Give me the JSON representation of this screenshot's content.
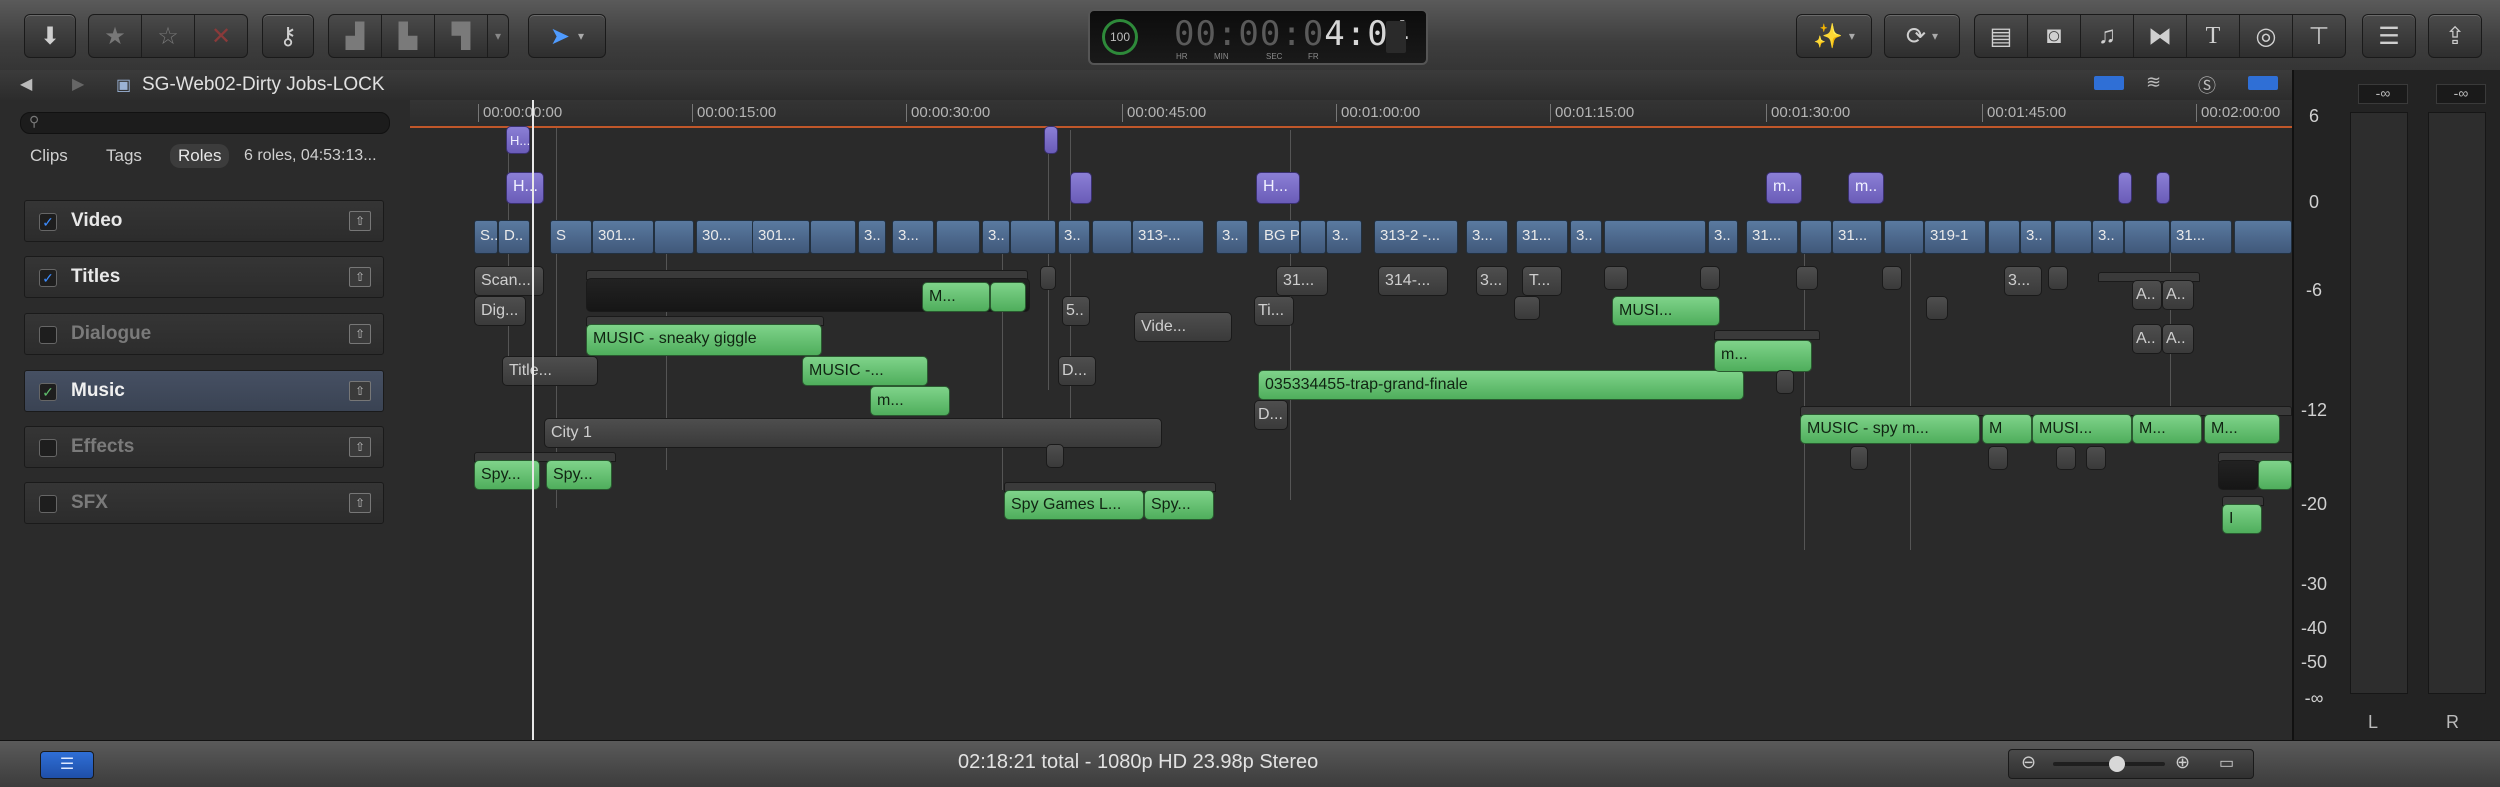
{
  "toolbar": {
    "timecode": {
      "percent": "100",
      "percent_unit": "%",
      "dim_digits": "00:00:0",
      "bright_digits": "4:04",
      "labels": [
        "HR",
        "MIN",
        "SEC",
        "FR"
      ]
    }
  },
  "titlebar": {
    "project_name": "SG-Web02-Dirty Jobs-LOCK"
  },
  "index": {
    "tabs": [
      "Clips",
      "Tags",
      "Roles"
    ],
    "selected_tab": "Roles",
    "summary": "6 roles, 04:53:13...",
    "roles": [
      {
        "label": "Video",
        "checked": true,
        "active": false
      },
      {
        "label": "Titles",
        "checked": true,
        "active": false
      },
      {
        "label": "Dialogue",
        "checked": false,
        "active": false
      },
      {
        "label": "Music",
        "checked": true,
        "active": true
      },
      {
        "label": "Effects",
        "checked": false,
        "active": false
      },
      {
        "label": "SFX",
        "checked": false,
        "active": false
      }
    ]
  },
  "ruler": {
    "ticks": [
      "00:00:00:00",
      "00:00:15:00",
      "00:00:30:00",
      "00:00:45:00",
      "00:01:00:00",
      "00:01:15:00",
      "00:01:30:00",
      "00:01:45:00",
      "00:02:00:00"
    ]
  },
  "primary_clips": [
    "S..",
    "D..",
    "S",
    "301...",
    "30...",
    "301...",
    "3..",
    "3...",
    "3..",
    "3..",
    "313-...",
    "3..",
    "BG P...",
    "3..",
    "313-2 -...",
    "3...",
    "31...",
    "3..",
    "3..",
    "31...",
    "31...",
    "319-1",
    "3..",
    "3..",
    "31..."
  ],
  "connected_clips": {
    "scan": "Scan...",
    "dig": "Dig...",
    "title": "Title...",
    "music_m": "M...",
    "sneaky": "MUSIC - sneaky giggle",
    "music_dash": "MUSIC -...",
    "m_short": "m...",
    "city": "City 1",
    "spy1": "Spy...",
    "spy2": "Spy...",
    "spy_games": "Spy Games L...",
    "spy3": "Spy...",
    "five": "5..",
    "d_short": "D...",
    "video": "Vide...",
    "ti": "Ti...",
    "thirty_one": "31...",
    "three_fourteen": "314-...",
    "three_dot": "3...",
    "t_short": "T...",
    "trap": "035334455-trap-grand-finale",
    "d2": "D...",
    "musi": "MUSI...",
    "m_dot": "m...",
    "spy_music": "MUSIC - spy m...",
    "m_single": "M",
    "musi2": "MUSI...",
    "m3": "M...",
    "m4": "M...",
    "a1": "A..",
    "a2": "A..",
    "a3": "A..",
    "a4": "A..",
    "h1": "H...",
    "h2": "H...",
    "h3": "H...",
    "m_purple1": "m..",
    "m_purple2": "m..",
    "three_second": "3...",
    "i_clip": "I"
  },
  "meters": {
    "peak_l": "-∞",
    "peak_r": "-∞",
    "scale": [
      "6",
      "0",
      "-6",
      "-12",
      "-20",
      "-30",
      "-40",
      "-50",
      "-∞"
    ],
    "channels": [
      "L",
      "R"
    ]
  },
  "statusbar": {
    "summary": "02:18:21 total - 1080p HD 23.98p Stereo"
  },
  "colors": {
    "audio_clip": "#5fbf6c",
    "primary_clip": "#4e6a90",
    "title_clip": "#7a6ec8",
    "ruler_line": "#c0572a",
    "checkbox": "#3c8cff"
  }
}
